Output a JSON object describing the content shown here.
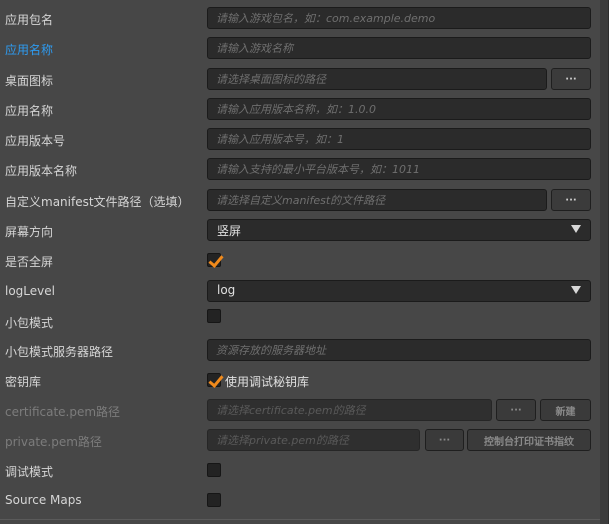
{
  "fields": {
    "package_name": {
      "label": "应用包名",
      "placeholder": "请输入游戏包名，如：com.example.demo"
    },
    "app_name": {
      "label": "应用名称",
      "placeholder": "请输入游戏名称"
    },
    "desktop_icon": {
      "label": "桌面图标",
      "placeholder": "请选择桌面图标的路径",
      "button": "···"
    },
    "app_name2": {
      "label": "应用名称",
      "placeholder": "请输入应用版本名称，如：1.0.0"
    },
    "version_code": {
      "label": "应用版本号",
      "placeholder": "请输入应用版本号，如：1"
    },
    "version_name": {
      "label": "应用版本名称",
      "placeholder": "请输入支持的最小平台版本号，如：1011"
    },
    "manifest_path": {
      "label": "自定义manifest文件路径（选填）",
      "placeholder": "请选择自定义manifest的文件路径",
      "button": "···"
    },
    "orientation": {
      "label": "屏幕方向",
      "value": "竖屏"
    },
    "fullscreen": {
      "label": "是否全屏",
      "checked": true
    },
    "log_level": {
      "label": "logLevel",
      "value": "log"
    },
    "small_package": {
      "label": "小包模式",
      "checked": false
    },
    "small_package_server": {
      "label": "小包模式服务器路径",
      "placeholder": "资源存放的服务器地址"
    },
    "keystore": {
      "label": "密钥库",
      "checked": true,
      "checkbox_label": "使用调试秘钥库"
    },
    "certificate": {
      "label": "certificate.pem路径",
      "placeholder": "请选择certificate.pem的路径",
      "button": "···",
      "button2": "新建"
    },
    "private_key": {
      "label": "private.pem路径",
      "placeholder": "请选择private.pem的路径",
      "button": "···",
      "button2": "控制台打印证书指纹"
    },
    "debug_mode": {
      "label": "调试模式",
      "checked": false
    },
    "source_maps": {
      "label": "Source Maps",
      "checked": false
    }
  },
  "colors": {
    "active_label": "#2e9bf0",
    "checkbox_tick": "#f08a1c"
  }
}
